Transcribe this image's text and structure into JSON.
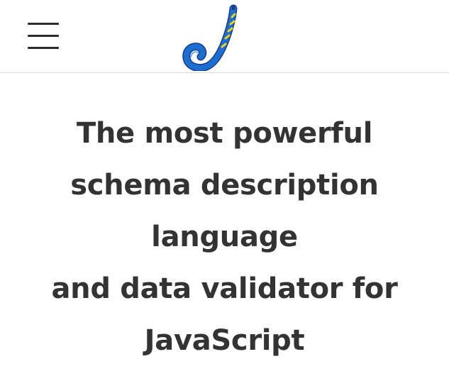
{
  "header": {
    "menu_icon": "hamburger-menu-icon",
    "logo_icon": "joi-logo-icon"
  },
  "hero": {
    "title_lines": [
      "The most powerful",
      "schema description",
      "language",
      "and data validator for",
      "JavaScript"
    ]
  },
  "colors": {
    "text": "#333333",
    "divider": "#dcdcdc",
    "logo_blue": "#1a6fd1",
    "logo_yellow": "#f2d21a"
  }
}
